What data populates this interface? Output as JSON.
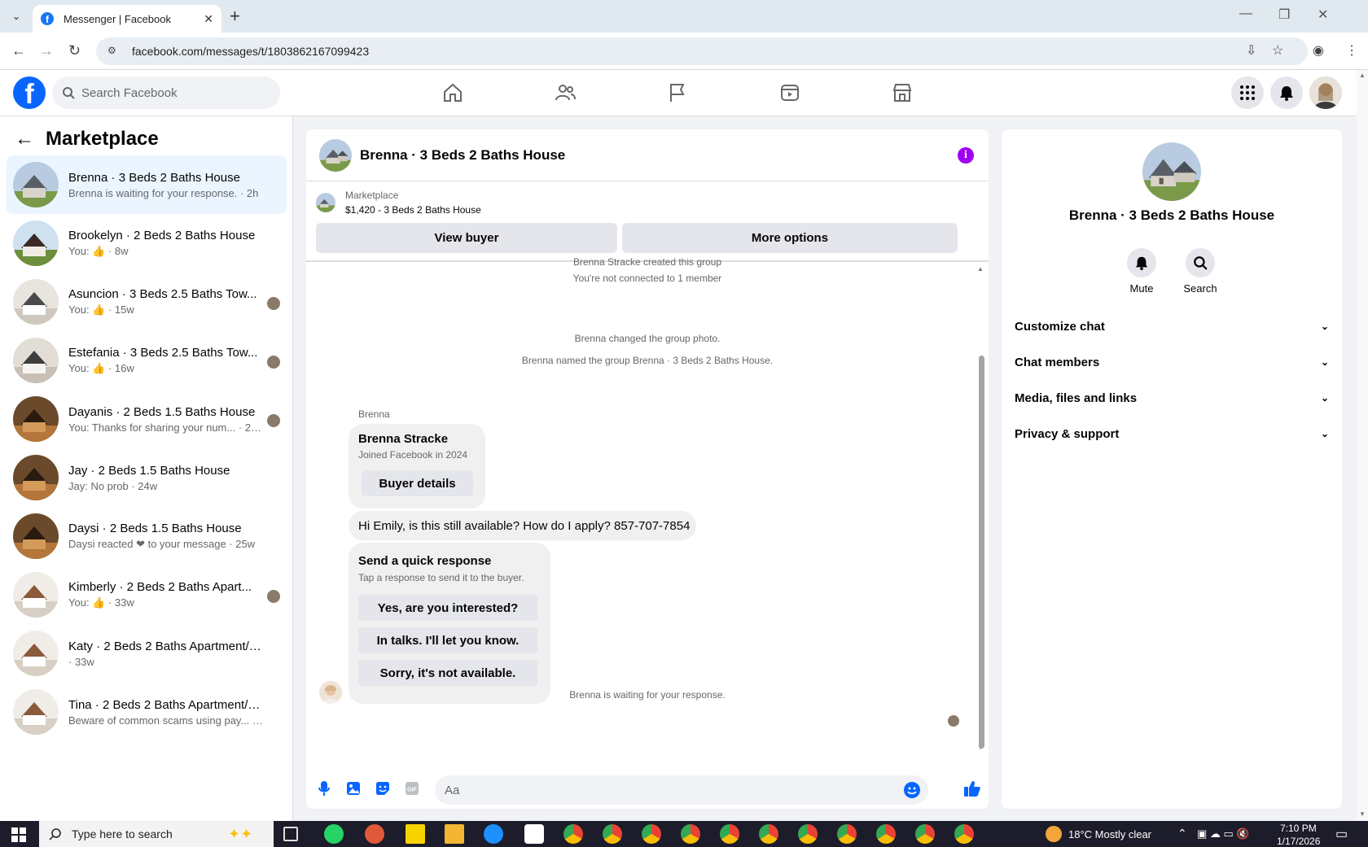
{
  "browser": {
    "tab_title": "Messenger | Facebook",
    "url": "facebook.com/messages/t/1803862167099423",
    "new_tab": "+"
  },
  "fb": {
    "search_placeholder": "Search Facebook",
    "nav_icons": [
      "home-icon",
      "friends-icon",
      "pages-flag-icon",
      "video-icon",
      "marketplace-icon"
    ]
  },
  "left_panel": {
    "title": "Marketplace",
    "conversations": [
      {
        "name": "Brenna · 3 Beds 2 Baths House",
        "sub": "Brenna is waiting for your response. · 2h",
        "active": true,
        "has_thumb": false
      },
      {
        "name": "Brookelyn · 2 Beds 2 Baths House",
        "sub": "You:",
        "time": " · 8w",
        "has_thumb": true
      },
      {
        "name": "Asuncion · 3 Beds 2.5 Baths Tow...",
        "sub": "You:",
        "time": " · 15w",
        "has_thumb": true
      },
      {
        "name": "Estefania · 3 Beds 2.5 Baths Tow...",
        "sub": "You:",
        "time": " · 16w",
        "has_thumb": true
      },
      {
        "name": "Dayanis · 2 Beds 1.5 Baths House",
        "sub": "You: Thanks for sharing your num... · 24w",
        "has_thumb": false
      },
      {
        "name": "Jay · 2 Beds 1.5 Baths House",
        "sub": "Jay: No prob · 24w",
        "has_thumb": false
      },
      {
        "name": "Daysi · 2 Beds 1.5 Baths House",
        "sub": "Daysi reacted ❤ to your message · 25w",
        "has_thumb": false
      },
      {
        "name": "Kimberly · 2 Beds 2 Baths Apart...",
        "sub": "You:",
        "time": " · 33w",
        "has_thumb": true
      },
      {
        "name": "Katy · 2 Beds 2 Baths Apartment/c...",
        "sub": " · 33w",
        "has_thumb": false
      },
      {
        "name": "Tina · 2 Beds 2 Baths Apartment/c...",
        "sub": "Beware of common scams using pay... · 33w",
        "has_thumb": false
      }
    ]
  },
  "chat": {
    "title": "Brenna · 3 Beds 2 Baths House",
    "info_icon": "i",
    "listing_source": "Marketplace",
    "listing_price": "$1,420 - 3 Beds 2 Baths House",
    "view_buyer": "View buyer",
    "more_options": "More options",
    "system_messages": [
      "Brenna Stracke created this group",
      "You're not connected to 1 member",
      "Brenna changed the group photo.",
      "Brenna named the group Brenna · 3 Beds 2 Baths House."
    ],
    "sender": "Brenna",
    "profile_name": "Brenna Stracke",
    "profile_joined": "Joined Facebook in 2024",
    "buyer_details": "Buyer details",
    "message": "Hi Emily, is this still available? How do I apply? 857-707-7854",
    "quick_title": "Send a quick response",
    "quick_sub": "Tap a response to send it to the buyer.",
    "quick_replies": [
      "Yes, are you interested?",
      "In talks. I'll let you know.",
      "Sorry, it's not available."
    ],
    "waiting": "Brenna is waiting for your response.",
    "composer_placeholder": "Aa"
  },
  "right_panel": {
    "title": "Brenna · 3 Beds 2 Baths House",
    "mute": "Mute",
    "search": "Search",
    "sections": [
      "Customize chat",
      "Chat members",
      "Media, files and links",
      "Privacy & support"
    ]
  },
  "taskbar": {
    "search_placeholder": "Type here to search",
    "weather": "18°C  Mostly clear",
    "time": "7:10 PM",
    "date": "1/17/2026"
  },
  "colors": {
    "fb_blue": "#0866ff",
    "active_conv": "#ebf5ff",
    "info_purple": "#a100f2"
  }
}
